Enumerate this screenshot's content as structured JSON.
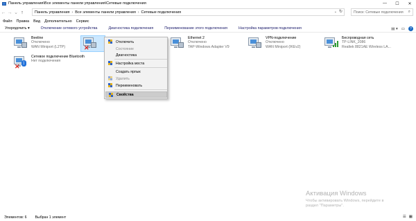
{
  "window": {
    "title": "Панель управления\\Все элементы панели управления\\Сетевые подключения",
    "minimize": "—",
    "maximize": "☐",
    "close": "✕"
  },
  "nav": {
    "back": "←",
    "forward": "→",
    "recent": "⌄",
    "up": "↑"
  },
  "address": {
    "crumbs": [
      "Панель управления",
      "Все элементы панели управления",
      "Сетевые подключения"
    ],
    "separator": "›",
    "dropdown": "⌄",
    "refresh": "↻"
  },
  "search": {
    "placeholder": "Поиск: Сетевые подключения",
    "icon": "search-icon",
    "glyph": "⌕"
  },
  "menu": [
    "Файл",
    "Правка",
    "Вид",
    "Дополнительно",
    "Сервис"
  ],
  "commands": [
    "Упорядочить ▾",
    "Отключение сетевого устройства",
    "Диагностика подключения",
    "Переименование этого подключения",
    "Настройка параметров подключения"
  ],
  "view": {
    "change_view": "▤ ▾",
    "preview_pane": "▭",
    "help": "?"
  },
  "connections": [
    {
      "name": "Beeline",
      "status": "Отключено",
      "device": "WAN Miniport (L2TP)",
      "icon": "vpn-connection-icon",
      "disconnected": false
    },
    {
      "name": "",
      "status": "",
      "device": "",
      "icon": "ethernet-connection-icon",
      "disconnected": true
    },
    {
      "name": "Ethernet 2",
      "status": "Отключено",
      "device": "TAP-Windows Adapter V9",
      "icon": "ethernet-connection-icon",
      "disconnected": false
    },
    {
      "name": "VPN-подключение",
      "status": "Отключено",
      "device": "WAN Miniport (IKEv2)",
      "icon": "vpn-connection-icon",
      "disconnected": false
    },
    {
      "name": "Беспроводная сеть",
      "status": "TP-LINK_2086",
      "device": "Realtek 8821AE Wireless LA...",
      "icon": "wifi-connection-icon",
      "disconnected": false
    },
    {
      "name": "Сетевое подключение Bluetooth",
      "status": "Нет подключения",
      "device": "",
      "icon": "bluetooth-connection-icon",
      "disconnected": true
    }
  ],
  "context_menu": {
    "items": [
      {
        "label": "Отключить",
        "enabled": true,
        "shield": true
      },
      {
        "label": "Состояние",
        "enabled": false,
        "shield": false
      },
      {
        "label": "Диагностика",
        "enabled": true,
        "shield": false
      },
      {
        "label": "Настройка моста",
        "enabled": true,
        "shield": true
      },
      {
        "label": "Создать ярлык",
        "enabled": true,
        "shield": false
      },
      {
        "label": "Удалить",
        "enabled": false,
        "shield": true
      },
      {
        "label": "Переименовать",
        "enabled": true,
        "shield": true
      },
      {
        "label": "Свойства",
        "enabled": true,
        "shield": true,
        "bold": true,
        "highlighted": true
      }
    ]
  },
  "watermark": {
    "title": "Активация Windows",
    "line1": "Чтобы активировать Windows, перейдите в",
    "line2": "раздел \"Параметры\"."
  },
  "status": {
    "items_count": "Элементов: 6",
    "selected": "Выбран 1 элемент",
    "details_view": "☰",
    "tiles_view": "▦"
  },
  "colors": {
    "selection_bg": "#cce8ff",
    "menu_bg": "#f2f2f2",
    "menu_highlight": "#cccccc",
    "link_text": "#1a1a6a",
    "disconnect_red": "#d9251c",
    "wifi_green": "#2d9c32",
    "bluetooth_blue": "#1e6fd9"
  }
}
